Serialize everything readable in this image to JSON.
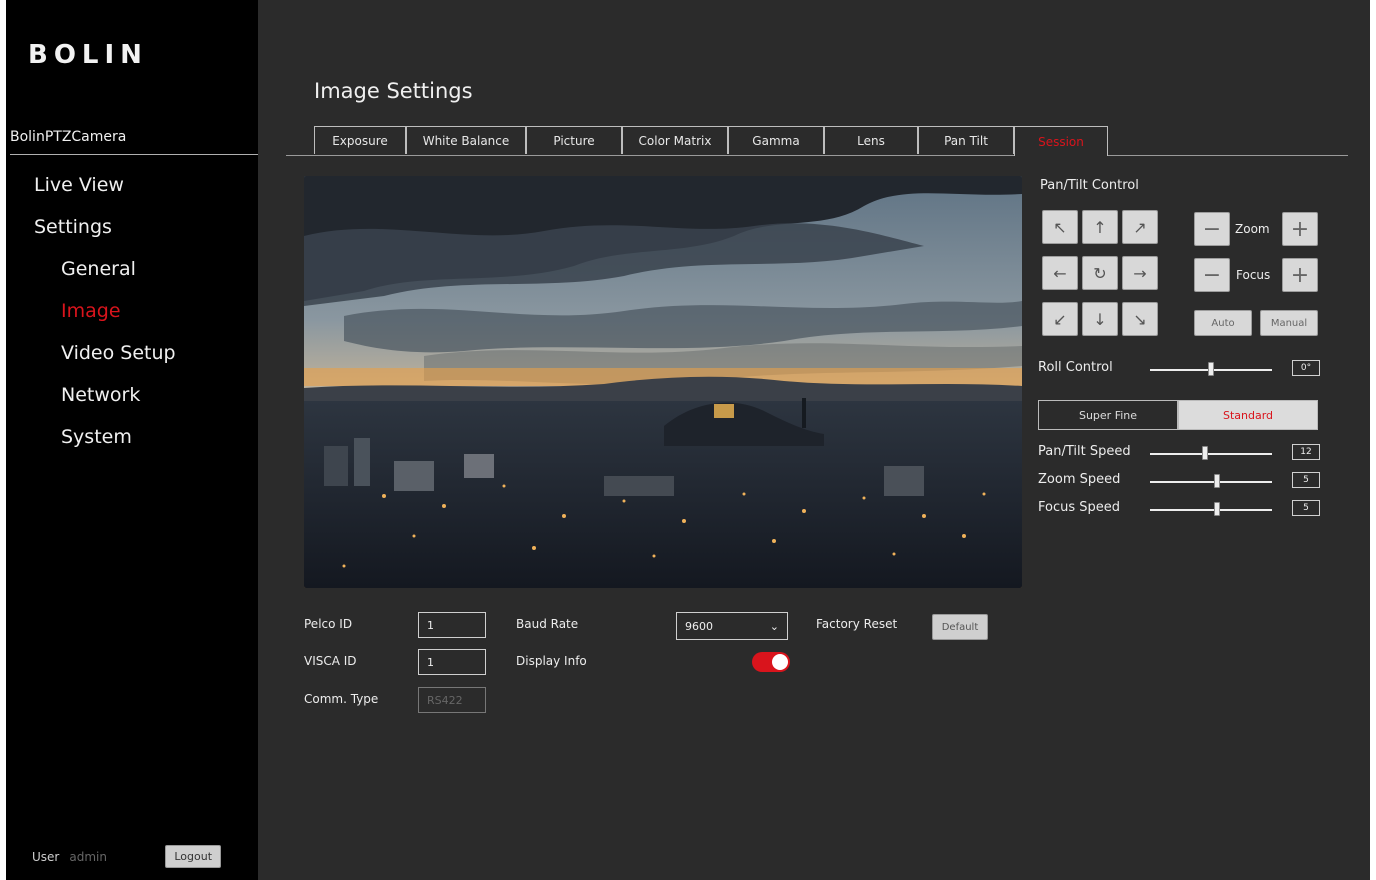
{
  "sidebar": {
    "logo": "BOLIN",
    "device_name": "BolinPTZCamera",
    "nav": {
      "live_view": "Live View",
      "settings": "Settings",
      "general": "General",
      "image": "Image",
      "video_setup": "Video Setup",
      "network": "Network",
      "system": "System"
    },
    "user_label": "User",
    "user_name": "admin",
    "logout_label": "Logout"
  },
  "main": {
    "title": "Image Settings",
    "tabs": [
      {
        "label": "Exposure"
      },
      {
        "label": "White Balance"
      },
      {
        "label": "Picture"
      },
      {
        "label": "Color Matrix"
      },
      {
        "label": "Gamma"
      },
      {
        "label": "Lens"
      },
      {
        "label": "Pan Tilt"
      },
      {
        "label": "Session"
      }
    ],
    "active_tab": "Session"
  },
  "panel": {
    "pan_tilt_title": "Pan/Tilt Control",
    "zoom_label": "Zoom",
    "focus_label": "Focus",
    "auto_label": "Auto",
    "manual_label": "Manual",
    "roll_label": "Roll Control",
    "roll_value": "0°",
    "roll_level": 0.5,
    "quality_super": "Super Fine",
    "quality_std": "Standard",
    "speed": [
      {
        "label": "Pan/Tilt Speed",
        "value": "12",
        "level": 0.45
      },
      {
        "label": "Zoom Speed",
        "value": "5",
        "level": 0.55
      },
      {
        "label": "Focus Speed",
        "value": "5",
        "level": 0.55
      }
    ]
  },
  "form": {
    "pelco_label": "Pelco ID",
    "pelco_value": "1",
    "visca_label": "VISCA ID",
    "visca_value": "1",
    "comm_label": "Comm. Type",
    "comm_value": "RS422",
    "baud_label": "Baud Rate",
    "baud_value": "9600",
    "display_label": "Display Info",
    "display_on": true,
    "factory_label": "Factory Reset",
    "default_label": "Default"
  },
  "colors": {
    "accent": "#d9141c",
    "sidebar_bg": "#000000",
    "main_bg": "#2b2b2b"
  }
}
